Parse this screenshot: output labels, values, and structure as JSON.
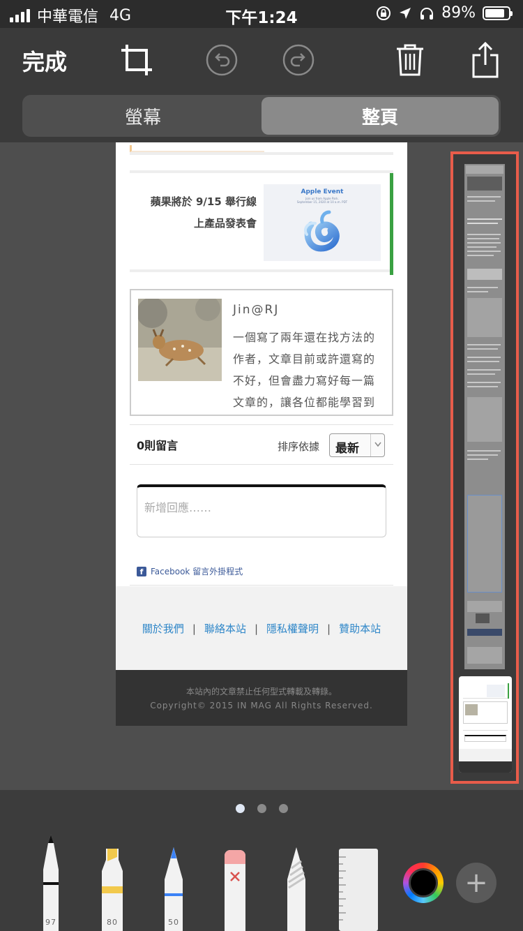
{
  "status_bar": {
    "carrier": "中華電信",
    "network": "4G",
    "time": "下午1:24",
    "battery": "89%"
  },
  "toolbar": {
    "done_label": "完成",
    "icons": [
      "crop-icon",
      "undo-icon",
      "redo-icon",
      "trash-icon",
      "share-icon"
    ]
  },
  "segmented": {
    "options": [
      "螢幕",
      "整頁"
    ],
    "selected": "整頁"
  },
  "page": {
    "related": {
      "title_line1": "蘋果將於 9/15 舉行線",
      "title_line2": "上產品發表會",
      "image_title": "Apple Event",
      "image_sub1": "Join us from Apple Park.",
      "image_sub2": "September 15, 2020 at 10 a.m. PDT"
    },
    "author": {
      "name": "Jin@RJ",
      "bio_lines": [
        "一個寫了兩年還在找方法的",
        "作者，文章目前或許還寫的",
        "不好，但會盡力寫好每一篇",
        "文章的，讓各位都能學習到"
      ]
    },
    "comments": {
      "count_label": "0則留言",
      "sort_label": "排序依據",
      "sort_value": "最新",
      "reply_placeholder": "新增回應……",
      "fb_plugin": "Facebook 留言外掛程式"
    },
    "footer": {
      "links": [
        "關於我們",
        "聯絡本站",
        "隱私權聲明",
        "贊助本站"
      ],
      "separator": "|",
      "notice": "本站內的文章禁止任何型式轉載及轉錄。",
      "copyright": "Copyright© 2015 IN MAG All Rights Reserved."
    }
  },
  "markup_tools": [
    {
      "name": "pen",
      "size": "97",
      "color": "#111111"
    },
    {
      "name": "highlighter",
      "size": "80",
      "color": "#f2c94c"
    },
    {
      "name": "pencil",
      "size": "50",
      "color": "#3b82f6"
    },
    {
      "name": "eraser",
      "size": "",
      "color": "#f4a6a6"
    },
    {
      "name": "lasso",
      "size": "",
      "color": "#cccccc"
    },
    {
      "name": "ruler",
      "size": "",
      "color": "#eeeeee"
    }
  ],
  "colors": {
    "thumbnail_border": "#e85c4a",
    "link_blue": "#2e86c8",
    "current_ink": "#000000"
  }
}
